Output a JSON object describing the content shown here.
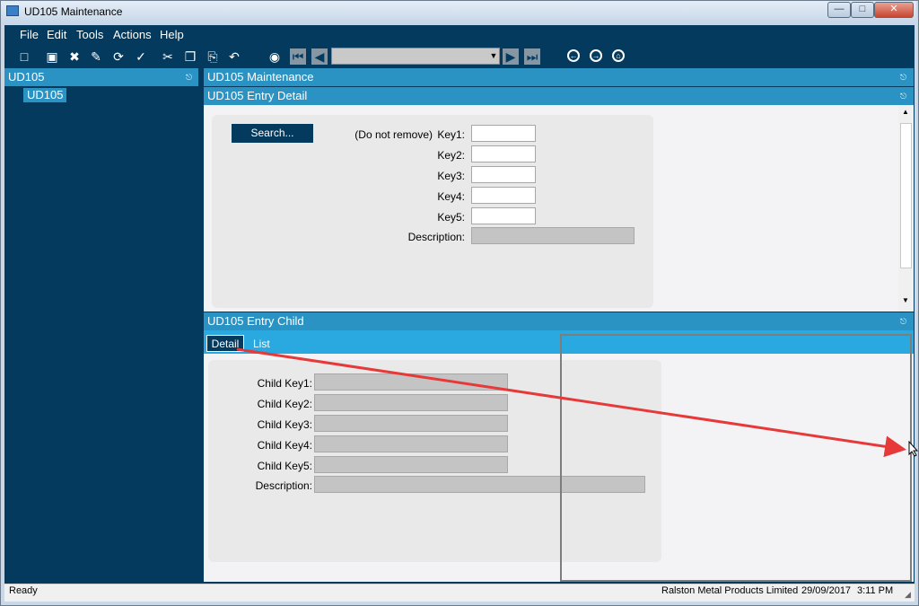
{
  "window": {
    "title": "UD105 Maintenance"
  },
  "menu": [
    "File",
    "Edit",
    "Tools",
    "Actions",
    "Help"
  ],
  "tree": {
    "header": "UD105",
    "node": "UD105"
  },
  "panels": {
    "maintenance_title": "UD105 Maintenance",
    "entry_title": "UD105 Entry Detail",
    "child_title": "UD105 Entry Child"
  },
  "entry": {
    "search_label": "Search...",
    "do_not_remove": "(Do not remove)",
    "key1_label": "Key1:",
    "key2_label": "Key2:",
    "key3_label": "Key3:",
    "key4_label": "Key4:",
    "key5_label": "Key5:",
    "description_label": "Description:"
  },
  "child": {
    "tabs": [
      "Detail",
      "List"
    ],
    "key1_label": "Child Key1:",
    "key2_label": "Child Key2:",
    "key3_label": "Child Key3:",
    "key4_label": "Child Key4:",
    "key5_label": "Child Key5:",
    "description_label": "Description:"
  },
  "status": {
    "text": "Ready",
    "company": "Ralston Metal Products Limited",
    "date": "29/09/2017",
    "time": "3:11 PM"
  },
  "annotation": {
    "arrow_color": "#e63a3a"
  },
  "colors": {
    "navy": "#033a5d",
    "panel_header": "#2a93c4",
    "tab_strip": "#2aa8e0"
  }
}
